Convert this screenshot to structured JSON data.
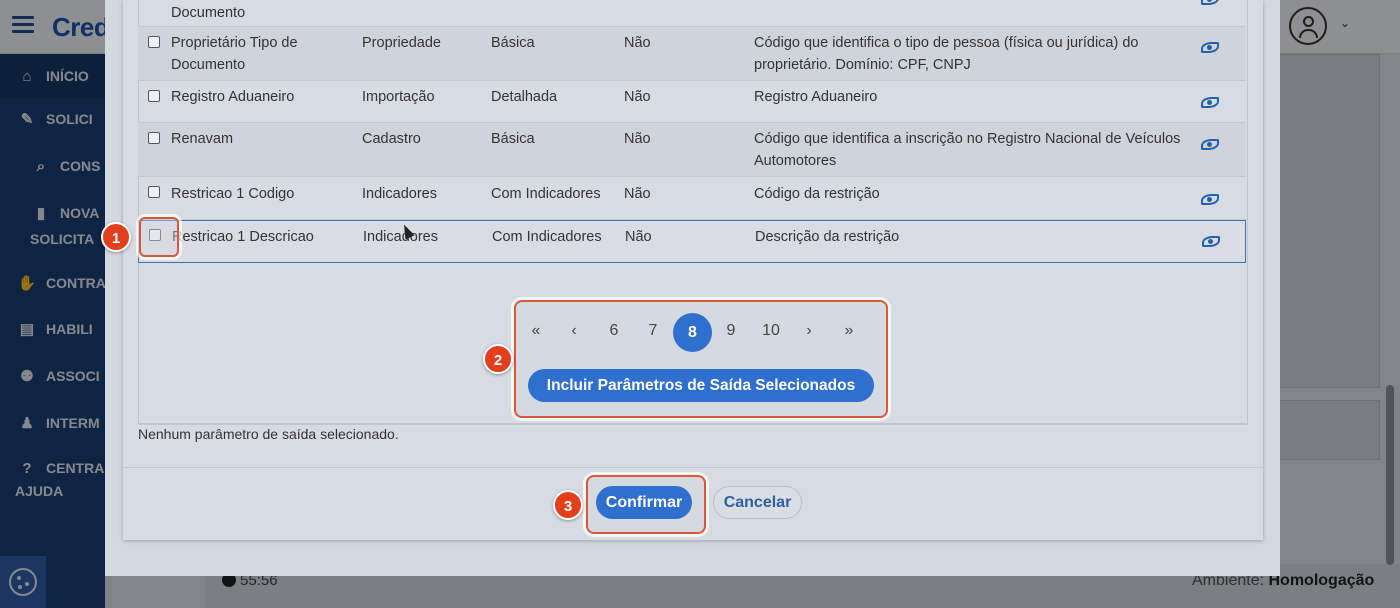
{
  "app": {
    "brand": "Cred"
  },
  "sidebar": {
    "items": [
      {
        "label": "INÍCIO",
        "icon": "home-icon"
      },
      {
        "label": "SOLICI",
        "icon": "edit-icon"
      },
      {
        "label": "CONS",
        "icon": "search-icon"
      },
      {
        "label": "NOVA",
        "label2": "SOLICITA",
        "icon": "file-icon"
      },
      {
        "label": "CONTRA",
        "icon": "handshake-icon"
      },
      {
        "label": "HABILI",
        "icon": "id-card-icon"
      },
      {
        "label": "ASSOCI",
        "icon": "users-icon"
      },
      {
        "label": "INTERM",
        "icon": "user-icon"
      },
      {
        "label": "CENTRA",
        "label2": "AJUDA",
        "icon": "question-icon"
      }
    ]
  },
  "footer": {
    "timer": "55:56",
    "env_label": "Ambiente:",
    "env_value": "Homologação"
  },
  "table": {
    "top_cut_name": "Documento",
    "rows": [
      {
        "name": "Proprietário Tipo de Documento",
        "category": "Propriedade",
        "level": "Básica",
        "required": "Não",
        "description": "Código que identifica o tipo de pessoa (física ou jurídica) do proprietário. Domínio: CPF, CNPJ"
      },
      {
        "name": "Registro Aduaneiro",
        "category": "Importação",
        "level": "Detalhada",
        "required": "Não",
        "description": "Registro Aduaneiro"
      },
      {
        "name": "Renavam",
        "category": "Cadastro",
        "level": "Básica",
        "required": "Não",
        "description": "Código que identifica a inscrição no Registro Nacional de Veículos Automotores"
      },
      {
        "name": "Restricao 1 Codigo",
        "category": "Indicadores",
        "level": "Com Indicadores",
        "required": "Não",
        "description": "Código da restrição"
      },
      {
        "name": "Restricao 1 Descricao",
        "category": "Indicadores",
        "level": "Com Indicadores",
        "required": "Não",
        "description": "Descrição da restrição"
      }
    ]
  },
  "pagination": {
    "first": "«",
    "prev": "‹",
    "pages": [
      "6",
      "7",
      "8",
      "9",
      "10"
    ],
    "current": "8",
    "next": "›",
    "last": "»"
  },
  "buttons": {
    "include": "Incluir Parâmetros de Saída Selecionados",
    "confirm": "Confirmar",
    "cancel": "Cancelar"
  },
  "status": {
    "no_selection": "Nenhum parâmetro de saída selecionado."
  },
  "markers": [
    "1",
    "2",
    "3"
  ],
  "colors": {
    "primary": "#2f6fce",
    "marker": "#e2401c",
    "sidebar": "#1b3f73"
  }
}
